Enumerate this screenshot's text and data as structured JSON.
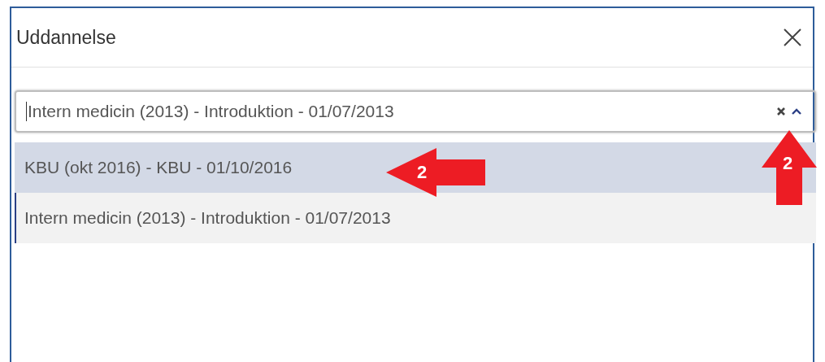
{
  "dialog": {
    "title": "Uddannelse"
  },
  "select": {
    "value": "Intern medicin (2013) - Introduktion - 01/07/2013",
    "expanded": true
  },
  "options": [
    {
      "label": "KBU (okt 2016) - KBU - 01/10/2016",
      "highlighted": true,
      "selected": false
    },
    {
      "label": "Intern medicin (2013) - Introduktion - 01/07/2013",
      "highlighted": false,
      "selected": true
    }
  ],
  "left_callout": {
    "label": "2"
  },
  "up_callout": {
    "label": "2"
  }
}
